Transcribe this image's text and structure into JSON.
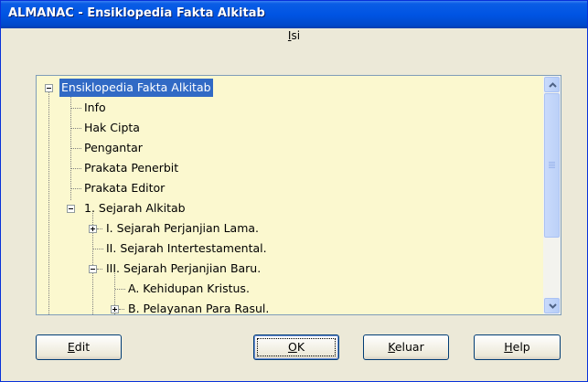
{
  "window": {
    "title": "ALMANAC - Ensiklopedia Fakta Alkitab"
  },
  "panel": {
    "label_accel": "I",
    "label_rest": "si"
  },
  "tree": {
    "items": [
      {
        "label": "Ensiklopedia Fakta Alkitab",
        "selected": true,
        "expanded": true
      },
      {
        "label": "Info"
      },
      {
        "label": "Hak Cipta"
      },
      {
        "label": "Pengantar"
      },
      {
        "label": "Prakata Penerbit"
      },
      {
        "label": "Prakata Editor"
      },
      {
        "label": "1. Sejarah Alkitab",
        "expanded": true
      },
      {
        "label": "I. Sejarah Perjanjian Lama.",
        "expanded": false
      },
      {
        "label": "II. Sejarah Intertestamental."
      },
      {
        "label": "III. Sejarah Perjanjian Baru.",
        "expanded": true
      },
      {
        "label": "A. Kehidupan Kristus."
      },
      {
        "label": "B. Pelayanan Para Rasul.",
        "expanded": false
      }
    ]
  },
  "buttons": {
    "edit": {
      "accel": "E",
      "rest": "dit"
    },
    "ok": {
      "accel": "O",
      "rest": "K"
    },
    "keluar": {
      "accel": "K",
      "rest": "eluar"
    },
    "help": {
      "accel": "H",
      "rest": "elp"
    }
  },
  "colors": {
    "titlebar": "#0054e3",
    "tree_background": "#fbf8cf",
    "selection": "#316ac5",
    "dialog_face": "#ece9d8"
  },
  "icons": {
    "scroll_up": "chevron-up-icon",
    "scroll_down": "chevron-down-icon",
    "expand": "plus-box-icon",
    "collapse": "minus-box-icon"
  }
}
